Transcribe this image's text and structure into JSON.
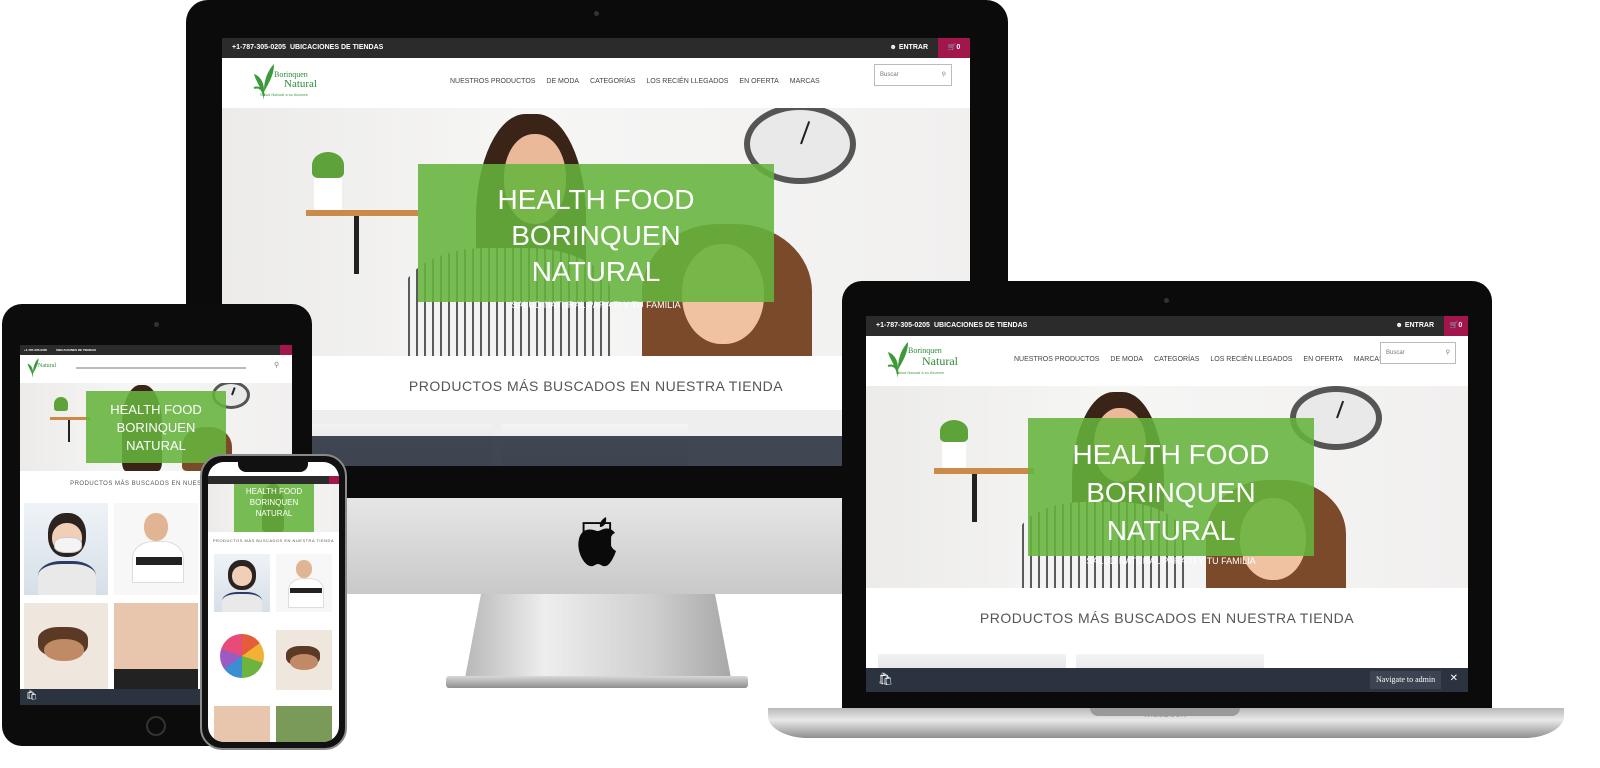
{
  "topbar": {
    "phone": "+1-787-305-0205",
    "stores": "UBICACIONES DE TIENDAS",
    "login": "ENTRAR",
    "cart_count": "0"
  },
  "logo": {
    "line1": "Borinquen",
    "line2": "Natural",
    "tagline": "Salud Natural a su Alcance"
  },
  "nav": [
    "NUESTROS PRODUCTOS",
    "DE MODA",
    "CATEGORÍAS",
    "LOS RECIÉN LLEGADOS",
    "EN OFERTA",
    "MARCAS"
  ],
  "search": {
    "placeholder": "Buscar"
  },
  "hero": {
    "title": "HEALTH FOOD BORINQUEN NATURAL",
    "title_line1_laptop": "HEALTH FOOD",
    "title_line2_laptop": "BORINQUEN NATURAL",
    "title_line1_imac": "HEALTH FOOD BORINQUEN",
    "title_line2_imac": "NATURAL",
    "subtitle": "SALUD NATURAL PARA TI Y TU FAMILIA"
  },
  "section": {
    "title": "PRODUCTOS MÁS BUSCADOS EN NUESTRA TIENDA"
  },
  "admin": {
    "label": "Navigate to admin",
    "close": "✕"
  },
  "device": {
    "laptop_brand": "MacBook"
  },
  "colors": {
    "green": "#65b43c",
    "dark": "#2b2b2b",
    "cart": "#a3164b",
    "admin": "#2c3340"
  },
  "icons": {
    "user": "user-icon",
    "cart": "cart-icon",
    "search": "search-icon",
    "apple": "apple-logo-icon",
    "shopify": "shopify-bag-icon"
  }
}
